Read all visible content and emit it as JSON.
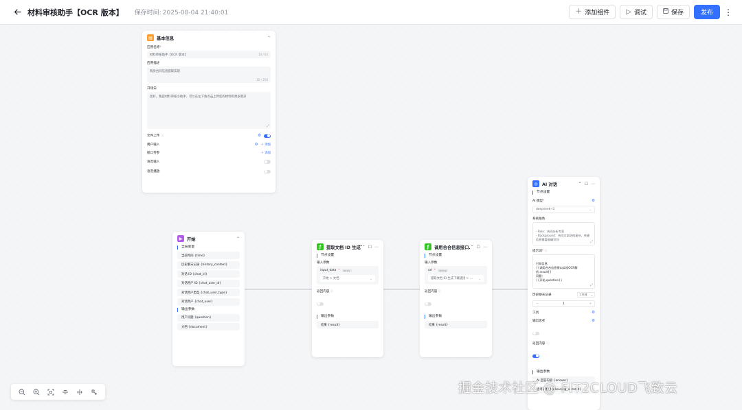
{
  "header": {
    "title": "材料审核助手【OCR 版本】",
    "save_time_label": "保存时间:",
    "save_time": "2025-08-04 21:40:01",
    "add_component": "添加组件",
    "debug": "调试",
    "save": "保存",
    "publish": "发布"
  },
  "basic_info": {
    "title": "基本信息",
    "name_label": "应用名称",
    "name_value": "材料审核助手【OCR 版本】",
    "name_count": "14 / 64",
    "desc_label": "应用描述",
    "desc_value": "购房合同信息提取实现",
    "desc_count": "10 / 256",
    "prologue_label": "开场白",
    "prologue_value": "您好，我是材料审核小助手，可以在左下角点击上传您的材料和更多需求",
    "file_upload": "文件上传",
    "user_input": "用户输入",
    "api_params": "接口传参",
    "voice_input": "语音输入",
    "voice_play": "语音播放",
    "add": "添加"
  },
  "start_node": {
    "title": "开始",
    "global_vars_label": "全局变量",
    "global_vars": [
      "当前时间 {time}",
      "历史聊天记录 {history_context}",
      "对话 ID {chat_id}",
      "对话用户 ID {chat_user_id}",
      "对话用户类型 {chat_user_type}",
      "对话用户 {chat_user}"
    ],
    "params_label": "输出参数",
    "params": [
      "用户问题 {question}",
      "文档 {document}"
    ]
  },
  "extract_node": {
    "title": "提取文档 ID 生成下…",
    "node_settings": "节点设置",
    "input_params": "输入参数",
    "param_name": "input_data",
    "param_type": "array",
    "param_value": "开始 > 文档",
    "return_content": "返回内容",
    "output_params": "输出参数",
    "output": "结果 {result}"
  },
  "call_node": {
    "title": "调用合合信息接口…",
    "node_settings": "节点设置",
    "input_params": "输入参数",
    "param_name": "url",
    "param_type": "string",
    "param_value": "提取文档 ID 生成下载链接 > …",
    "return_content": "返回内容",
    "output_params": "输出参数",
    "output": "结果 {result}"
  },
  "ai_node": {
    "title": "AI 对话",
    "node_settings": "节点设置",
    "model_label": "AI 模型",
    "model_value": "deepseek-r1",
    "role_label": "系统角色",
    "role_text": "- Role：合同分析专家\n- Background：合同文本结构复杂，关键信息需要准确识别",
    "prompt_label": "提示词",
    "prompt_text": "已知信息：\n{{调用合合信息接口实现OCR解析.result}}\n问题：\n{{开始.question}}",
    "history_label": "历史聊天记录",
    "history_mode": "工作流",
    "history_value": "1",
    "tools_label": "工具",
    "thinking_label": "输出思考",
    "return_label": "返回内容",
    "output_params": "输出参数",
    "output": "AI 回答内容 {answer}",
    "output2": "思考过程 {reasoning_content}"
  },
  "zoom_controls": [
    "zoom-out",
    "zoom-in",
    "fit-view",
    "align-vertical",
    "align-horizontal",
    "auto-layout"
  ],
  "watermark": "掘金技术社区 @ FIT2CLOUD飞致云",
  "colors": {
    "primary": "#3370ff",
    "basic_icon": "#ff9d2b",
    "start_icon": "#b35dea",
    "extract_icon": "#34c724",
    "call_icon": "#34c724",
    "ai_icon": "#3370ff"
  }
}
